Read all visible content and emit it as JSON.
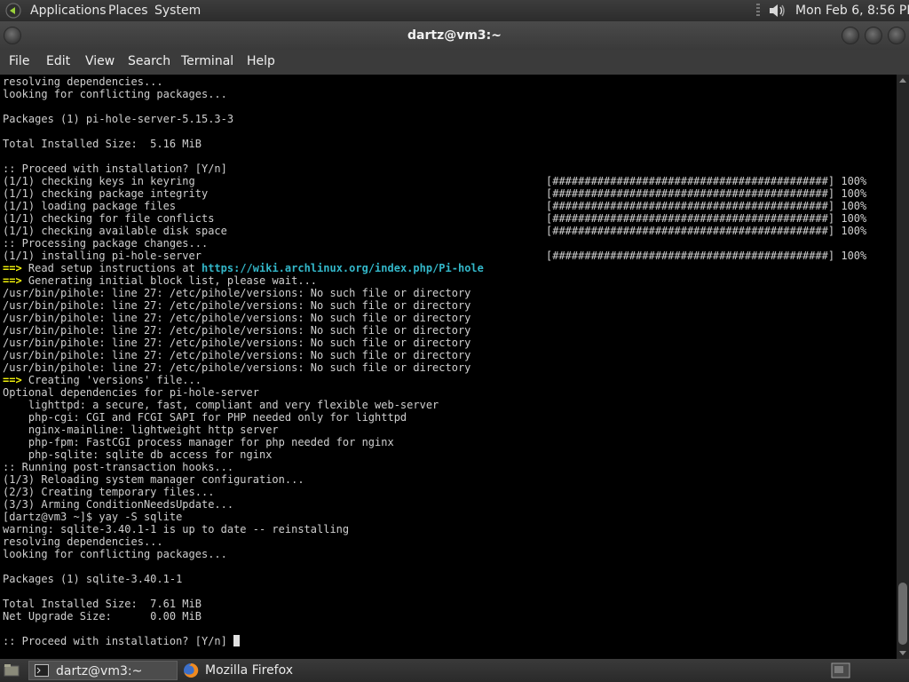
{
  "top_panel": {
    "menus": [
      "Applications",
      "Places",
      "System"
    ],
    "icons": {
      "logo": "gnome-foot-icon",
      "volume": "speaker-icon"
    },
    "clock": "Mon Feb  6,  8:56 PM"
  },
  "window": {
    "title": "dartz@vm3:~",
    "menubar": [
      "File",
      "Edit",
      "View",
      "Search",
      "Terminal",
      "Help"
    ]
  },
  "terminal": {
    "lines": [
      "resolving dependencies...",
      "looking for conflicting packages...",
      "",
      "Packages (1) pi-hole-server-5.15.3-3",
      "",
      "Total Installed Size:  5.16 MiB",
      "",
      ":: Proceed with installation? [Y/n]",
      "(1/1) checking keys in keyring",
      "(1/1) checking package integrity",
      "(1/1) loading package files",
      "(1/1) checking for file conflicts",
      "(1/1) checking available disk space",
      ":: Processing package changes...",
      "(1/1) installing pi-hole-server",
      "",
      "",
      "/usr/bin/pihole: line 27: /etc/pihole/versions: No such file or directory",
      "/usr/bin/pihole: line 27: /etc/pihole/versions: No such file or directory",
      "/usr/bin/pihole: line 27: /etc/pihole/versions: No such file or directory",
      "/usr/bin/pihole: line 27: /etc/pihole/versions: No such file or directory",
      "/usr/bin/pihole: line 27: /etc/pihole/versions: No such file or directory",
      "/usr/bin/pihole: line 27: /etc/pihole/versions: No such file or directory",
      "/usr/bin/pihole: line 27: /etc/pihole/versions: No such file or directory",
      "",
      "Optional dependencies for pi-hole-server",
      "    lighttpd: a secure, fast, compliant and very flexible web-server",
      "    php-cgi: CGI and FCGI SAPI for PHP needed only for lighttpd",
      "    nginx-mainline: lightweight http server",
      "    php-fpm: FastCGI process manager for php needed for nginx",
      "    php-sqlite: sqlite db access for nginx",
      ":: Running post-transaction hooks...",
      "(1/3) Reloading system manager configuration...",
      "(2/3) Creating temporary files...",
      "(3/3) Arming ConditionNeedsUpdate...",
      "[dartz@vm3 ~]$ yay -S sqlite",
      "warning: sqlite-3.40.1-1 is up to date -- reinstalling",
      "resolving dependencies...",
      "looking for conflicting packages...",
      "",
      "Packages (1) sqlite-3.40.1-1",
      "",
      "Total Installed Size:  7.61 MiB",
      "Net Upgrade Size:      0.00 MiB",
      "",
      ":: Proceed with installation? [Y/n] "
    ],
    "arrow_lines": {
      "15": {
        "arrow": "==>",
        "text": " Read setup instructions at ",
        "link": "https://wiki.archlinux.org/index.php/Pi-hole"
      },
      "16": {
        "arrow": "==>",
        "text": " Generating initial block list, please wait...",
        "link": ""
      },
      "24": {
        "arrow": "==>",
        "text": " Creating 'versions' file...",
        "link": ""
      }
    },
    "progress": [
      {
        "row": 8,
        "bar": "[###########################################]",
        "percent": "100%"
      },
      {
        "row": 9,
        "bar": "[###########################################]",
        "percent": "100%"
      },
      {
        "row": 10,
        "bar": "[###########################################]",
        "percent": "100%"
      },
      {
        "row": 11,
        "bar": "[###########################################]",
        "percent": "100%"
      },
      {
        "row": 12,
        "bar": "[###########################################]",
        "percent": "100%"
      },
      {
        "row": 14,
        "bar": "[###########################################]",
        "percent": "100%"
      }
    ]
  },
  "taskbar": {
    "tasks": [
      {
        "label": "dartz@vm3:~",
        "icon": "terminal-icon",
        "active": true
      },
      {
        "label": "Mozilla Firefox",
        "icon": "firefox-icon",
        "active": false
      }
    ],
    "icons": {
      "show_desktop": "show-desktop-icon",
      "workspace": "workspace-switcher-icon"
    }
  }
}
